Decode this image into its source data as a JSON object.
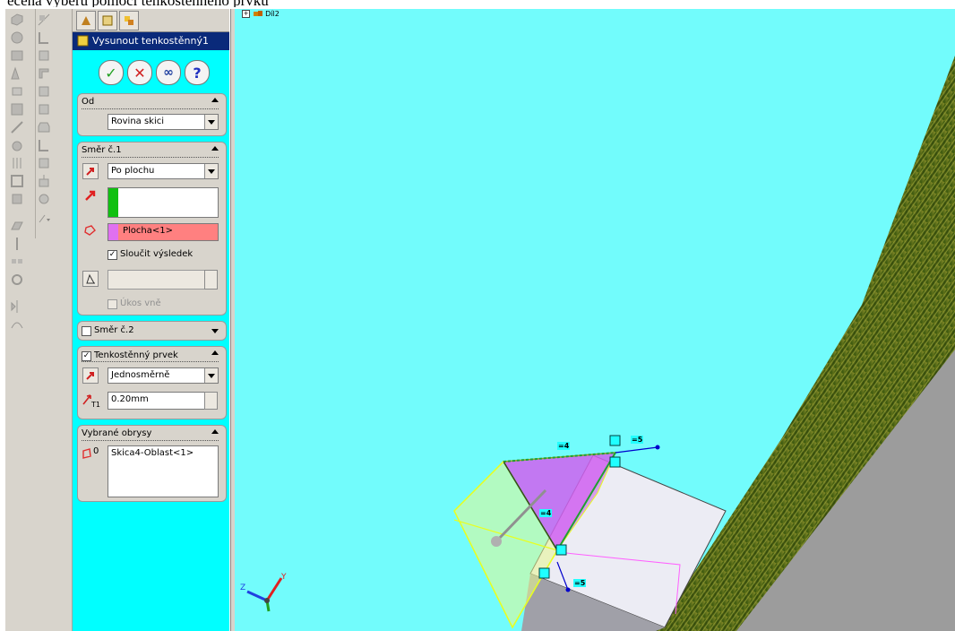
{
  "document": {
    "caption": "ečená výběru pomocí tenkostěnného prvku"
  },
  "property_manager": {
    "feature_title": "Vysunout tenkostěnný1",
    "actions": {
      "ok": "✓",
      "cancel": "✕",
      "preview": "∞",
      "help": "?"
    },
    "group_from": {
      "title": "Od",
      "value": "Rovina skici"
    },
    "group_dir1": {
      "title": "Směr č.1",
      "end_condition": "Po plochu",
      "direction_value": "",
      "face_value": "Plocha<1>",
      "merge_label": "Sloučit výsledek",
      "merge_checked": "✓",
      "draft_value": "",
      "draft_outward_label": "Úkos vně"
    },
    "group_dir2": {
      "title": "Směr č.2"
    },
    "group_thin": {
      "title": "Tenkostěnný prvek",
      "checked": "✓",
      "type": "Jednosměrně",
      "thickness": "0.20mm",
      "thickness_symbol": "T1"
    },
    "group_contours": {
      "title": "Vybrané obrysy",
      "items": [
        "Skica4-Oblast<1>"
      ],
      "contour_symbol": "0"
    }
  },
  "viewport": {
    "tree_root": "Díl2",
    "dimensions": {
      "top_left": "=4",
      "top_right": "=5",
      "middle": "=4",
      "bottom": "=5"
    },
    "axes": {
      "z": "Z",
      "y": "Y"
    }
  },
  "colors": {
    "viewport_bg": "#72fcfc",
    "pm_bg": "#00ffff",
    "title_bar": "#0a2a7a",
    "face_highlight": "#ff8080",
    "preview_pink": "#d060f0"
  }
}
